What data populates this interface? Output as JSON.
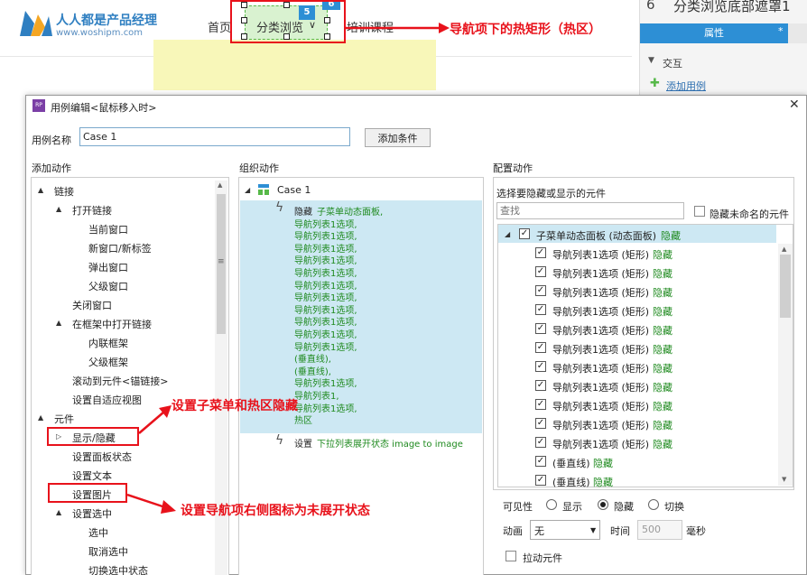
{
  "site": {
    "logo_cn": "人人都是产品经理",
    "logo_url": "www.woshipm.com",
    "nav_home": "首页",
    "nav_browse": "分类浏览",
    "nav_training": "培训课程",
    "badge_5": "5",
    "badge_6": "6"
  },
  "annotations": {
    "top": "导航项下的热矩形（热区）",
    "show_hide": "设置子菜单和热区隐藏",
    "set_image": "设置导航项右侧图标为未展开状态"
  },
  "right_panel": {
    "index": "6",
    "title": "分类浏览底部遮罩1",
    "tab_properties": "属性",
    "tab_star": "*",
    "section_interaction": "交互",
    "add_case": "添加用例"
  },
  "dialog": {
    "title": "用例编辑<鼠标移入时>",
    "case_name_label": "用例名称",
    "case_name_value": "Case 1",
    "add_condition": "添加条件",
    "col_add_actions": "添加动作",
    "col_organize": "组织动作",
    "col_configure": "配置动作"
  },
  "add_actions_tree": [
    {
      "label": "链接",
      "level": 0,
      "twisty": "▲"
    },
    {
      "label": "打开链接",
      "level": 1,
      "twisty": "▲"
    },
    {
      "label": "当前窗口",
      "level": 2
    },
    {
      "label": "新窗口/新标签",
      "level": 2
    },
    {
      "label": "弹出窗口",
      "level": 2
    },
    {
      "label": "父级窗口",
      "level": 2
    },
    {
      "label": "关闭窗口",
      "level": 1
    },
    {
      "label": "在框架中打开链接",
      "level": 1,
      "twisty": "▲"
    },
    {
      "label": "内联框架",
      "level": 2
    },
    {
      "label": "父级框架",
      "level": 2
    },
    {
      "label": "滚动到元件<锚链接>",
      "level": 1
    },
    {
      "label": "设置自适应视图",
      "level": 1
    },
    {
      "label": "元件",
      "level": 0,
      "twisty": "▲"
    },
    {
      "label": "显示/隐藏",
      "level": 1,
      "twisty": "▷"
    },
    {
      "label": "设置面板状态",
      "level": 1
    },
    {
      "label": "设置文本",
      "level": 1
    },
    {
      "label": "设置图片",
      "level": 1
    },
    {
      "label": "设置选中",
      "level": 1,
      "twisty": "▲"
    },
    {
      "label": "选中",
      "level": 2
    },
    {
      "label": "取消选中",
      "level": 2
    },
    {
      "label": "切换选中状态",
      "level": 2
    }
  ],
  "organize": {
    "case": "Case 1",
    "action1_prefix": "隐藏",
    "action1_lines": [
      "子菜单动态面板,",
      "导航列表1选项,",
      "导航列表1选项,",
      "导航列表1选项,",
      "导航列表1选项,",
      "导航列表1选项,",
      "导航列表1选项,",
      "导航列表1选项,",
      "导航列表1选项,",
      "导航列表1选项,",
      "导航列表1选项,",
      "导航列表1选项,",
      "(垂直线),",
      "(垂直线),",
      "导航列表1选项,",
      "导航列表1,",
      "导航列表1选项,",
      "热区"
    ],
    "action2_prefix": "设置",
    "action2_text": "下拉列表展开状态 image to image"
  },
  "configure": {
    "select_label": "选择要隐藏或显示的元件",
    "search_placeholder": "查找",
    "hide_unnamed": "隐藏未命名的元件",
    "root": {
      "name": "子菜单动态面板 (动态面板)",
      "state": "隐藏"
    },
    "items": [
      {
        "name": "导航列表1选项 (矩形)",
        "state": "隐藏"
      },
      {
        "name": "导航列表1选项 (矩形)",
        "state": "隐藏"
      },
      {
        "name": "导航列表1选项 (矩形)",
        "state": "隐藏"
      },
      {
        "name": "导航列表1选项 (矩形)",
        "state": "隐藏"
      },
      {
        "name": "导航列表1选项 (矩形)",
        "state": "隐藏"
      },
      {
        "name": "导航列表1选项 (矩形)",
        "state": "隐藏"
      },
      {
        "name": "导航列表1选项 (矩形)",
        "state": "隐藏"
      },
      {
        "name": "导航列表1选项 (矩形)",
        "state": "隐藏"
      },
      {
        "name": "导航列表1选项 (矩形)",
        "state": "隐藏"
      },
      {
        "name": "导航列表1选项 (矩形)",
        "state": "隐藏"
      },
      {
        "name": "导航列表1选项 (矩形)",
        "state": "隐藏"
      },
      {
        "name": "(垂直线)",
        "state": "隐藏"
      },
      {
        "name": "(垂直线)",
        "state": "隐藏"
      }
    ],
    "visibility_label": "可见性",
    "opt_show": "显示",
    "opt_hide": "隐藏",
    "opt_toggle": "切换",
    "anim_label": "动画",
    "anim_value": "无",
    "time_label": "时间",
    "time_value": "500",
    "time_unit": "毫秒",
    "pull_label": "拉动元件"
  }
}
